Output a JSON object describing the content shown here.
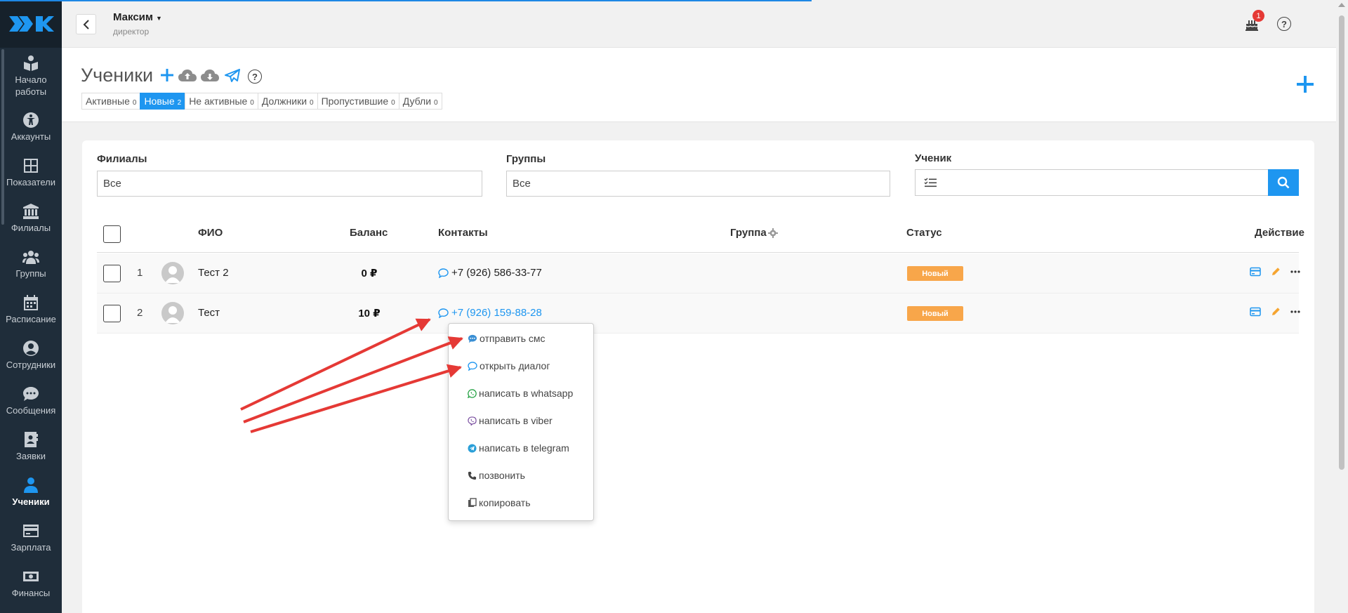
{
  "user": {
    "name": "Максим",
    "role": "директор",
    "notifications": "1"
  },
  "sidebar": {
    "items": [
      {
        "label": "Начало работы",
        "icon": "book-reader-icon"
      },
      {
        "label": "Аккаунты",
        "icon": "accessibility-icon"
      },
      {
        "label": "Показатели",
        "icon": "grid-icon"
      },
      {
        "label": "Филиалы",
        "icon": "building-icon"
      },
      {
        "label": "Группы",
        "icon": "users-icon"
      },
      {
        "label": "Расписание",
        "icon": "calendar-icon"
      },
      {
        "label": "Сотрудники",
        "icon": "user-circle-icon"
      },
      {
        "label": "Сообщения",
        "icon": "comment-icon"
      },
      {
        "label": "Заявки",
        "icon": "address-book-icon"
      },
      {
        "label": "Ученики",
        "icon": "user-icon",
        "active": true
      },
      {
        "label": "Зарплата",
        "icon": "credit-card-icon"
      },
      {
        "label": "Финансы",
        "icon": "money-icon"
      }
    ]
  },
  "page": {
    "title": "Ученики"
  },
  "tabs": [
    {
      "label": "Активные",
      "count": "0"
    },
    {
      "label": "Новые",
      "count": "2",
      "active": true
    },
    {
      "label": "Не активные",
      "count": "0"
    },
    {
      "label": "Должники",
      "count": "0"
    },
    {
      "label": "Пропустившие",
      "count": "0"
    },
    {
      "label": "Дубли",
      "count": "0"
    }
  ],
  "filters": {
    "branches": {
      "label": "Филиалы",
      "value": "Все"
    },
    "groups": {
      "label": "Группы",
      "value": "Все"
    },
    "student": {
      "label": "Ученик",
      "value": ""
    }
  },
  "table": {
    "columns": {
      "fio": "ФИО",
      "balance": "Баланс",
      "contacts": "Контакты",
      "group": "Группа",
      "status": "Статус",
      "action": "Действие"
    },
    "rows": [
      {
        "num": "1",
        "name": "Тест 2",
        "balance": "0 ₽",
        "phone": "+7 (926) 586-33-77",
        "group": "",
        "status": "Новый"
      },
      {
        "num": "2",
        "name": "Тест",
        "balance": "10 ₽",
        "phone": "+7 (926) 159-88-28",
        "group": "",
        "status": "Новый"
      }
    ]
  },
  "context_menu": {
    "items": [
      {
        "label": "отправить смс",
        "icon": "sms-icon"
      },
      {
        "label": "открыть диалог",
        "icon": "comment-outline-icon"
      },
      {
        "label": "написать в whatsapp",
        "icon": "whatsapp-icon"
      },
      {
        "label": "написать в viber",
        "icon": "viber-icon"
      },
      {
        "label": "написать в telegram",
        "icon": "telegram-icon"
      },
      {
        "label": "позвонить",
        "icon": "phone-icon"
      },
      {
        "label": "копировать",
        "icon": "copy-icon"
      }
    ]
  },
  "colors": {
    "accent": "#1e96f0",
    "sidebar": "#1f2d3a",
    "status_new": "#f8a64a",
    "annotation_arrow": "#e53935"
  }
}
